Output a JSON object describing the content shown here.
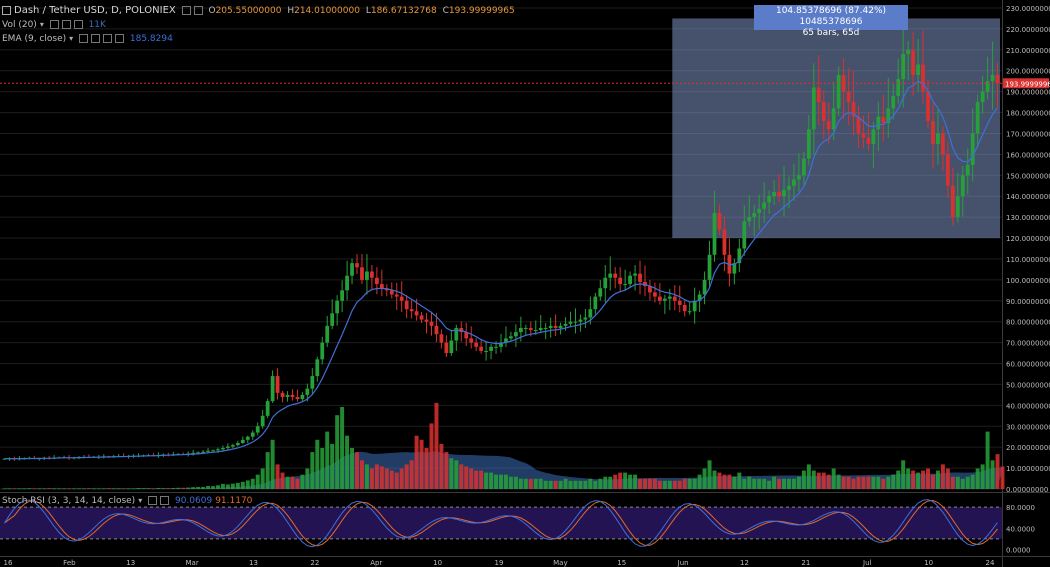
{
  "header": {
    "symbol": "Dash / Tether USD, D, POLONIEX",
    "o_label": "O",
    "o_value": "205.55000000",
    "h_label": "H",
    "h_value": "214.01000000",
    "l_label": "L",
    "l_value": "186.67132768",
    "c_label": "C",
    "c_value": "193.99999965"
  },
  "indicators": {
    "vol_label": "Vol (20)",
    "vol_value": "11K",
    "ema_label": "EMA (9, close)",
    "ema_value": "185.8294",
    "stoch_label": "Stoch RSI (3, 3, 14, 14, close)",
    "stoch_k_value": "90.0609",
    "stoch_d_value": "91.1170"
  },
  "measure": {
    "line1": "104.85378696 (87.42%) 10485378696",
    "line2": "65 bars, 65d"
  },
  "price_tag": "193.99999965",
  "colors": {
    "up": "#26a13a",
    "down": "#d9312f",
    "ema": "#3f6fd8",
    "stoch_k": "#3f6fd8",
    "stoch_d": "#e06a2a",
    "measure": "#5b7cc8",
    "volume_ma": "#3d6fb8"
  },
  "chart_data": {
    "type": "candlestick",
    "x_labels": [
      "16",
      "Feb",
      "13",
      "Mar",
      "13",
      "22",
      "Apr",
      "10",
      "19",
      "May",
      "15",
      "Jun",
      "12",
      "21",
      "Jul",
      "10",
      "24"
    ],
    "y_ticks": [
      "0.00000000",
      "10.00000000",
      "20.00000000",
      "30.00000000",
      "40.00000000",
      "50.00000000",
      "60.00000000",
      "70.00000000",
      "80.00000000",
      "90.00000000",
      "100.00000000",
      "110.00000000",
      "120.00000000",
      "130.00000000",
      "140.00000000",
      "150.00000000",
      "160.00000000",
      "170.00000000",
      "180.00000000",
      "190.00000000",
      "200.00000000",
      "210.00000000",
      "220.00000000",
      "230.00000000"
    ],
    "ylim": [
      0,
      230
    ],
    "stoch_ticks": [
      "0.0000",
      "40.0000",
      "80.0000"
    ],
    "stoch_ylim": [
      -5,
      105
    ],
    "measure_range": {
      "from": 120,
      "to": 225,
      "start_date": "May 26",
      "end_date": "Jul 30"
    },
    "current_price": 194,
    "close": [
      14.5,
      14.6,
      14.4,
      14.6,
      14.7,
      14.8,
      14.6,
      14.7,
      14.9,
      14.8,
      15,
      15.1,
      15.2,
      15.0,
      15.1,
      15.2,
      15.3,
      15.2,
      15.4,
      15.5,
      15.6,
      15.5,
      15.7,
      15.8,
      15.6,
      15.8,
      15.9,
      16.0,
      16.1,
      16.2,
      16.0,
      16.3,
      16.5,
      16.4,
      16.6,
      16.8,
      16.7,
      17,
      17.3,
      17.5,
      17.8,
      18.3,
      18.5,
      19,
      19.6,
      20.3,
      21,
      22,
      23.5,
      25,
      27,
      30,
      35,
      42,
      54,
      46,
      44,
      45,
      44,
      43,
      45,
      48,
      54,
      62,
      70,
      78,
      84,
      90,
      95,
      102,
      108,
      106,
      100,
      104,
      101,
      98,
      96,
      95,
      93,
      92,
      90,
      86,
      85,
      83,
      81,
      80,
      78,
      74,
      70,
      65,
      71,
      77,
      75,
      72,
      70,
      68,
      66,
      66,
      68,
      68,
      70,
      72,
      73,
      75,
      77,
      77,
      76,
      76,
      77,
      77,
      78,
      77,
      78,
      79,
      80,
      80,
      81,
      82,
      86,
      92,
      96,
      101,
      103,
      101,
      98,
      98,
      102,
      103,
      99,
      97,
      94,
      92,
      90,
      91,
      92,
      90,
      88,
      85,
      85,
      90,
      93,
      100,
      112,
      132,
      124,
      112,
      103,
      108,
      115,
      128,
      130,
      132,
      134,
      137,
      140,
      142,
      140,
      143,
      145,
      148,
      150,
      158,
      172,
      192,
      185,
      176,
      172,
      182,
      198,
      190,
      185,
      178,
      170,
      168,
      165,
      172,
      178,
      175,
      182,
      188,
      196,
      208,
      210,
      198,
      203,
      190,
      176,
      165,
      170,
      160,
      145,
      130,
      140,
      150,
      155,
      170,
      185,
      190,
      195,
      198,
      194
    ],
    "volume_k": [
      0.3,
      0.3,
      0.3,
      0.3,
      0.3,
      0.4,
      0.3,
      0.3,
      0.3,
      0.4,
      0.3,
      0.3,
      0.3,
      0.3,
      0.3,
      0.3,
      0.3,
      0.4,
      0.3,
      0.3,
      0.3,
      0.4,
      0.3,
      0.3,
      0.3,
      0.3,
      0.3,
      0.5,
      0.4,
      0.4,
      0.3,
      0.5,
      0.4,
      0.4,
      0.5,
      0.6,
      0.6,
      0.7,
      0.9,
      1,
      1,
      1.5,
      1.4,
      1.8,
      2.5,
      2.2,
      2.6,
      3,
      3.5,
      4.2,
      5,
      7,
      10,
      18,
      24,
      12,
      8,
      6,
      6,
      5,
      7,
      10,
      18,
      24,
      20,
      28,
      22,
      36,
      40,
      26,
      20,
      18,
      14,
      12,
      10,
      12,
      11,
      10,
      9,
      8,
      10,
      12,
      14,
      26,
      24,
      20,
      32,
      42,
      22,
      18,
      15,
      14,
      12,
      11,
      10,
      9,
      9,
      8,
      8,
      7,
      7,
      7,
      6,
      6,
      5,
      5,
      5,
      5,
      5,
      4,
      4,
      4,
      4,
      5,
      4,
      4,
      4,
      4,
      5,
      4,
      5,
      6,
      6,
      7,
      8,
      8,
      7,
      7,
      5,
      5,
      5,
      5,
      4,
      4,
      4,
      4,
      4,
      5,
      5,
      5,
      7,
      10,
      14,
      9,
      8,
      7,
      7,
      6,
      8,
      5,
      6,
      5,
      5,
      5,
      4,
      6,
      5,
      5,
      5,
      5,
      6,
      9,
      12,
      9,
      8,
      8,
      7,
      10,
      7,
      6,
      6,
      5,
      6,
      6,
      6,
      6,
      6,
      5,
      6,
      7,
      9,
      14,
      10,
      9,
      8,
      9,
      10,
      7,
      9,
      12,
      10,
      6,
      6,
      5,
      6,
      7,
      10,
      12,
      28,
      14,
      17,
      11
    ],
    "series": [
      {
        "name": "EMA (9, close)",
        "source": "close",
        "period": 9
      },
      {
        "name": "Vol (20)",
        "source": "volume_k",
        "period": 20
      }
    ]
  }
}
